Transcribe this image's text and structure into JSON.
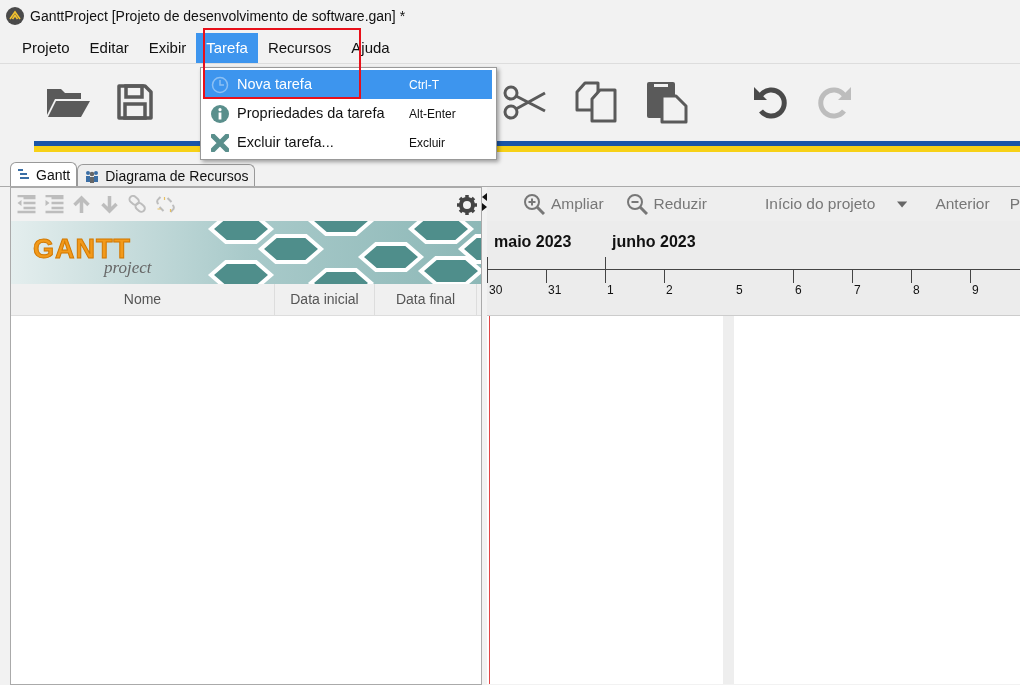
{
  "window": {
    "title": "GanttProject [Projeto de desenvolvimento de software.gan] *"
  },
  "menu_bar": [
    {
      "label": "Projeto",
      "selected": false
    },
    {
      "label": "Editar",
      "selected": false
    },
    {
      "label": "Exibir",
      "selected": false
    },
    {
      "label": "Tarefa",
      "selected": true
    },
    {
      "label": "Recursos",
      "selected": false
    },
    {
      "label": "Ajuda",
      "selected": false
    }
  ],
  "open_menu": {
    "items": [
      {
        "label": "Nova tarefa",
        "shortcut": "Ctrl-T",
        "selected": true
      },
      {
        "label": "Propriedades da tarefa",
        "shortcut": "Alt-Enter",
        "selected": false
      },
      {
        "label": "Excluir tarefa...",
        "shortcut": "Excluir",
        "selected": false
      }
    ]
  },
  "highlight_frame": true,
  "tabs": [
    {
      "label": "Gantt",
      "selected": true
    },
    {
      "label": "Diagrama de Recursos",
      "selected": false
    }
  ],
  "task_table": {
    "logo": {
      "title": "GANTT",
      "subtitle": "project"
    },
    "columns": [
      "Nome",
      "Data inicial",
      "Data final"
    ]
  },
  "chart_toolbar": [
    {
      "kind": "zoom-in",
      "label": "Ampliar"
    },
    {
      "kind": "zoom-out",
      "label": "Reduzir"
    },
    {
      "kind": "dropdown",
      "label": "Início do projeto"
    },
    {
      "kind": "plain",
      "label": "Anterior"
    },
    {
      "kind": "plain",
      "label": "P"
    }
  ],
  "timeline": {
    "today_marker": true,
    "days": [
      {
        "label": "30",
        "month": "maio 2023"
      },
      {
        "label": "31"
      },
      {
        "label": "1",
        "month": "junho 2023"
      },
      {
        "label": "2"
      },
      {
        "label": "5",
        "weekend_before": true
      },
      {
        "label": "6"
      },
      {
        "label": "7"
      },
      {
        "label": "8"
      },
      {
        "label": "9"
      }
    ]
  }
}
